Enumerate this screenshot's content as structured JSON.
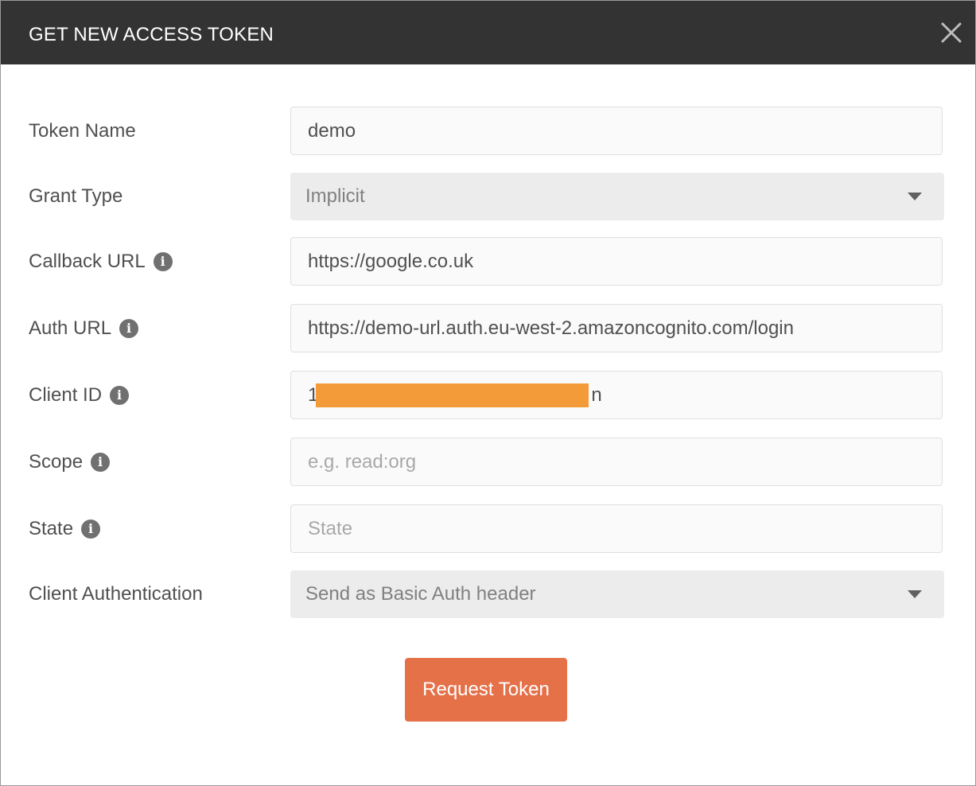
{
  "dialog": {
    "title": "GET NEW ACCESS TOKEN",
    "close_icon": "close-icon"
  },
  "form": {
    "token_name": {
      "label": "Token Name",
      "value": "demo"
    },
    "grant_type": {
      "label": "Grant Type",
      "value": "Implicit"
    },
    "callback_url": {
      "label": "Callback URL",
      "value": "https://google.co.uk",
      "info_icon": "info-icon"
    },
    "auth_url": {
      "label": "Auth URL",
      "value": "https://demo-url.auth.eu-west-2.amazoncognito.com/login",
      "info_icon": "info-icon"
    },
    "client_id": {
      "label": "Client ID",
      "value_start": "1",
      "value_end": "n",
      "info_icon": "info-icon"
    },
    "scope": {
      "label": "Scope",
      "placeholder": "e.g. read:org",
      "info_icon": "info-icon"
    },
    "state": {
      "label": "State",
      "placeholder": "State",
      "info_icon": "info-icon"
    },
    "client_authentication": {
      "label": "Client Authentication",
      "value": "Send as Basic Auth header"
    }
  },
  "actions": {
    "request_token_label": "Request Token"
  },
  "colors": {
    "header_bg": "#333333",
    "accent_button": "#e57149",
    "redaction": "#f29b38"
  }
}
